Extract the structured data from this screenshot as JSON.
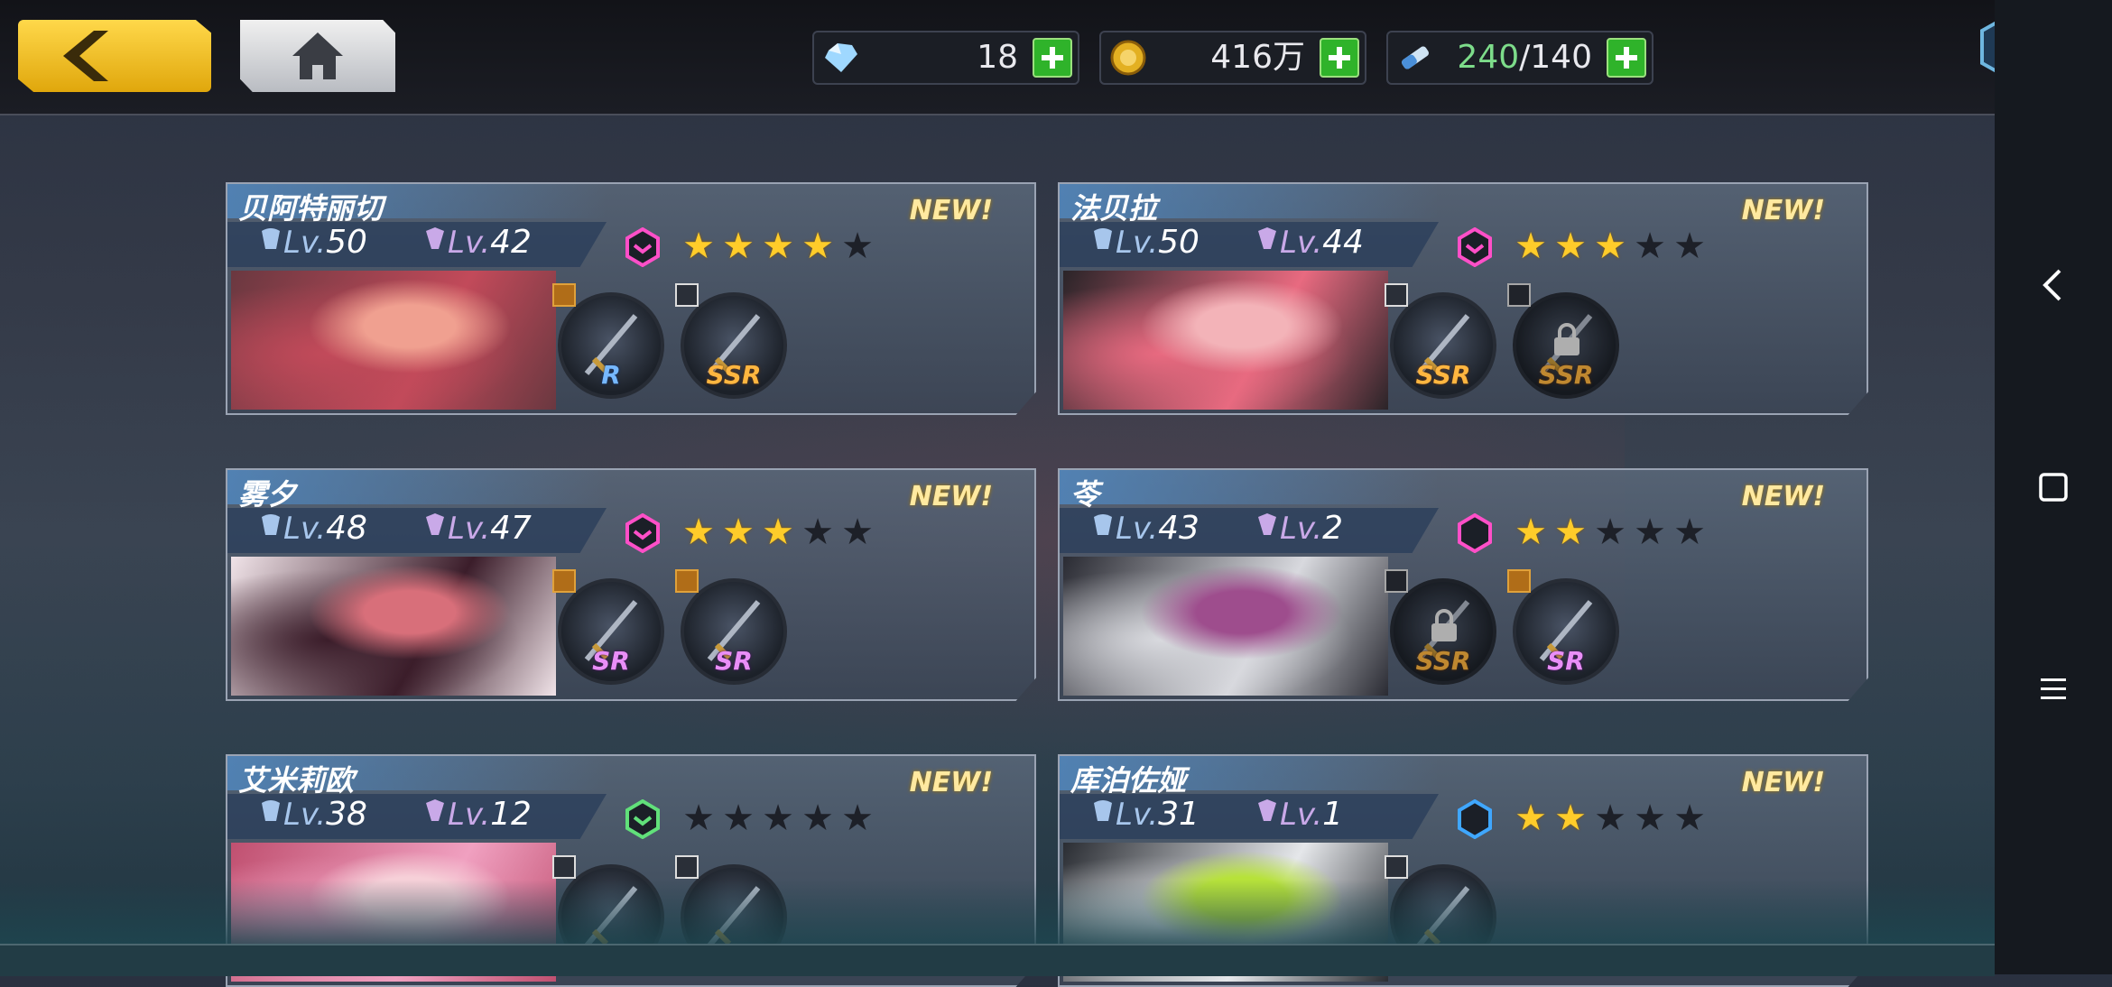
{
  "resources": {
    "gems": "18",
    "coins": "416万",
    "stamina_current": "240",
    "stamina_sep": "/",
    "stamina_max": "140"
  },
  "cards": [
    {
      "name": "贝阿特丽切",
      "new": "NEW!",
      "lv_prefix": "Lv.",
      "lv1": "50",
      "lv2": "42",
      "stars": 4,
      "hex_color": "#ff4fc8",
      "equip": [
        {
          "rarity": "R",
          "locked": false,
          "tag": "gold"
        },
        {
          "rarity": "SSR",
          "locked": false,
          "tag": "white"
        }
      ],
      "portrait_colors": [
        "#c24a5a",
        "#f0a090",
        "#6a3840"
      ]
    },
    {
      "name": "法贝拉",
      "new": "NEW!",
      "lv_prefix": "Lv.",
      "lv1": "50",
      "lv2": "44",
      "stars": 3,
      "hex_color": "#ff4fc8",
      "equip": [
        {
          "rarity": "SSR",
          "locked": false,
          "tag": "white"
        },
        {
          "rarity": "SSR",
          "locked": true,
          "tag": "white"
        }
      ],
      "portrait_colors": [
        "#e86a80",
        "#f3b3b8",
        "#2a2428"
      ]
    },
    {
      "name": "雾夕",
      "new": "NEW!",
      "lv_prefix": "Lv.",
      "lv1": "48",
      "lv2": "47",
      "stars": 3,
      "hex_color": "#ff4fc8",
      "equip": [
        {
          "rarity": "SR",
          "locked": false,
          "tag": "gold"
        },
        {
          "rarity": "SR",
          "locked": false,
          "tag": "gold"
        }
      ],
      "portrait_colors": [
        "#3b1d2a",
        "#d86f7a",
        "#f0e3e8"
      ]
    },
    {
      "name": "苓",
      "new": "NEW!",
      "lv_prefix": "Lv.",
      "lv1": "43",
      "lv2": "2",
      "stars": 2,
      "hex_color": "#ff4fc8",
      "equip": [
        {
          "rarity": "SSR",
          "locked": true,
          "tag": "white"
        },
        {
          "rarity": "SR",
          "locked": false,
          "tag": "gold"
        }
      ],
      "portrait_colors": [
        "#d8d9de",
        "#9e4d8d",
        "#2a2b33"
      ]
    },
    {
      "name": "艾米莉欧",
      "new": "NEW!",
      "lv_prefix": "Lv.",
      "lv1": "38",
      "lv2": "12",
      "stars": 0,
      "hex_color": "#61e07a",
      "equip": [
        {
          "rarity": "",
          "locked": false,
          "tag": "white"
        },
        {
          "rarity": "",
          "locked": false,
          "tag": "white"
        }
      ],
      "portrait_colors": [
        "#f0a0c0",
        "#f6d0d8",
        "#c05070"
      ]
    },
    {
      "name": "库泊佐娅",
      "new": "NEW!",
      "lv_prefix": "Lv.",
      "lv1": "31",
      "lv2": "1",
      "stars": 2,
      "hex_color": "#3fa7ff",
      "equip": [
        {
          "rarity": "",
          "locked": false,
          "tag": "white"
        }
      ],
      "portrait_colors": [
        "#e5e7ea",
        "#b7e23a",
        "#2a2d33"
      ]
    }
  ],
  "nav": {
    "back_icon": "chevron-left-icon",
    "home_icon": "square-icon",
    "menu_icon": "menu-lines-icon"
  }
}
